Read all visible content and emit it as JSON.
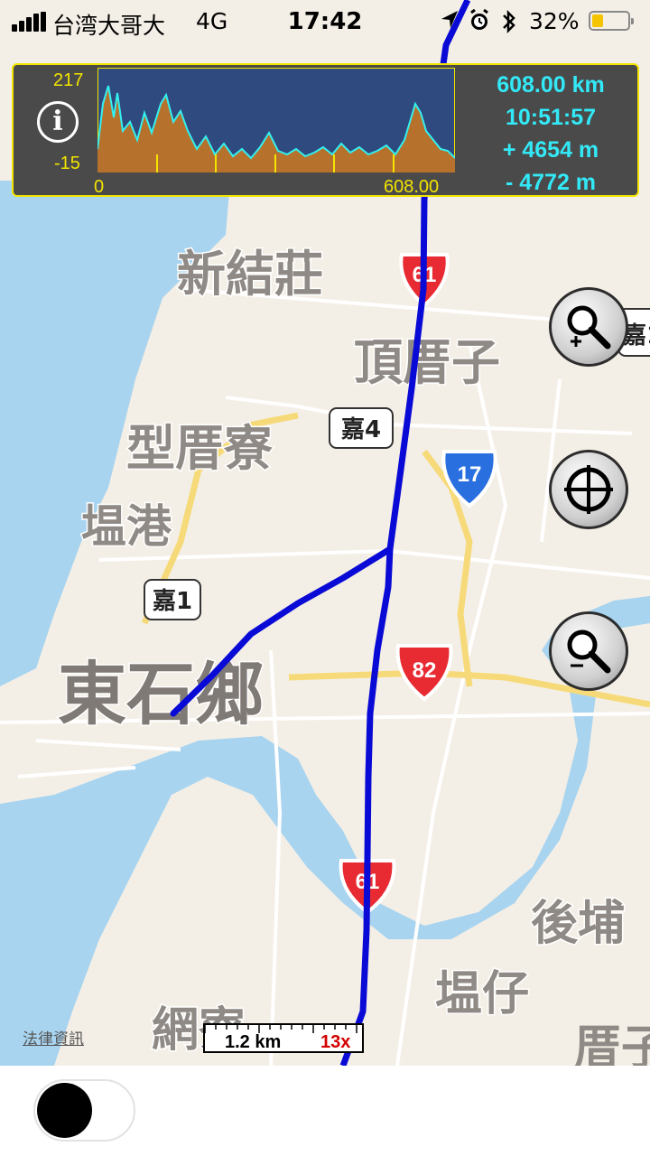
{
  "status_bar": {
    "carrier": "台湾大哥大",
    "network": "4G",
    "time": "17:42",
    "battery": "32%",
    "battery_level": 0.32
  },
  "track_panel": {
    "y_max": "217",
    "y_min": "-15",
    "x_min": "0",
    "x_max": "608.00",
    "distance": "608.00 km",
    "duration": "10:51:57",
    "ascent": "+ 4654 m",
    "descent": "- 4772 m",
    "info_label": "i"
  },
  "map": {
    "place_labels": [
      "新結莊",
      "頂厝子",
      "型厝寮",
      "塭港",
      "東石鄉",
      "後埔",
      "塭仔",
      "網寮",
      "嘉1",
      "厝子"
    ],
    "road_shields": [
      "嘉4",
      "嘉1"
    ],
    "highway_shields": [
      "61",
      "17",
      "82",
      "61"
    ],
    "legal_link": "法律資訊",
    "scale": "1.2 km",
    "zoom": "13x"
  },
  "colors": {
    "water": "#a8d4f0",
    "land": "#f4efe6",
    "track": "#0a0ad6",
    "panel_accent": "#f3e400",
    "stats_text": "#33e9f7"
  },
  "controls": {
    "zoom_in": "zoom-in-icon",
    "locate": "crosshair-icon",
    "zoom_out": "zoom-out-icon"
  },
  "toggle": {
    "state": "off"
  }
}
